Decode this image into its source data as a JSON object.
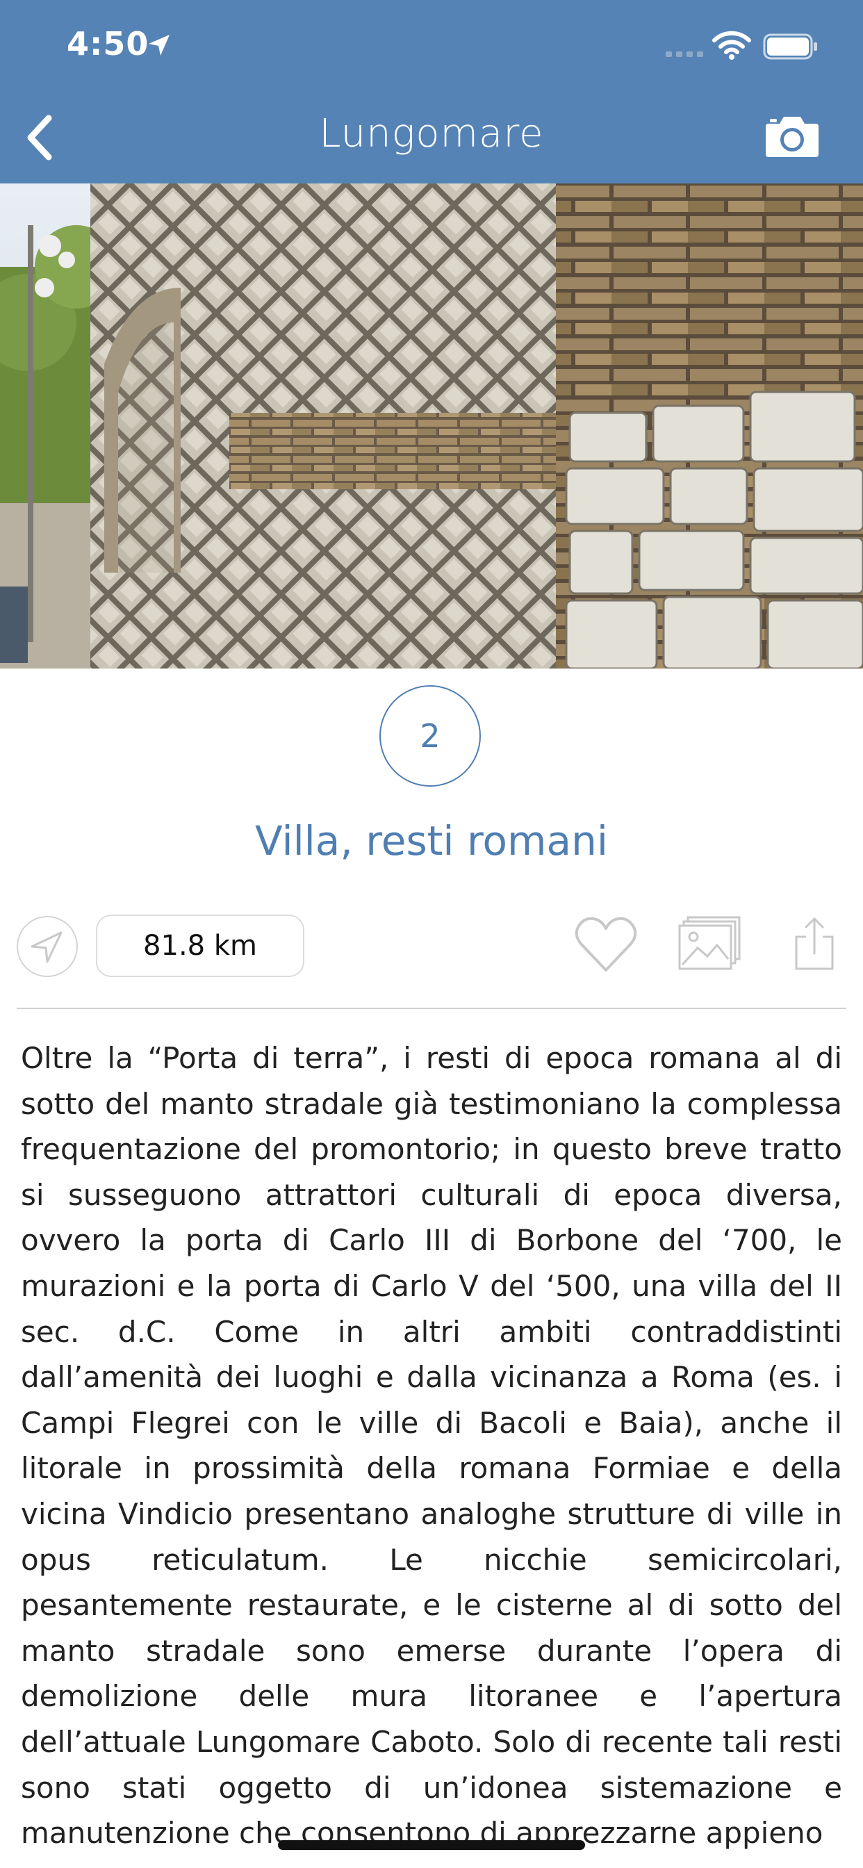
{
  "status_bar": {
    "time": "4:50",
    "icons": [
      "location-arrow-icon",
      "signal-icon",
      "wifi-icon",
      "battery-icon"
    ]
  },
  "nav": {
    "back_icon": "chevron-left-icon",
    "title": "Lungomare",
    "camera_icon": "camera-icon"
  },
  "hero_image": {
    "description": "Roman ruins: arched wall of opus reticulatum, brick and stone masonry along a seaside promenade"
  },
  "poi": {
    "number": "2",
    "title": "Villa, resti romani"
  },
  "actions": {
    "navigate_icon": "navigation-arrow-icon",
    "distance": "81.8 km",
    "favorite_icon": "heart-icon",
    "gallery_icon": "gallery-icon",
    "share_icon": "share-icon"
  },
  "description": "Oltre la “Porta di terra”, i resti di epoca romana al di sotto del manto stradale già testimoniano la complessa frequentazione del promontorio; in questo breve tratto si susseguono attrattori culturali di epoca diversa, ovvero la porta di Carlo III di Borbone del ‘700, le murazioni e la porta di Carlo V del ‘500, una villa del II sec. d.C. Come in altri ambiti contraddistinti dall’amenità dei luoghi e dalla vicinanza a Roma (es. i Campi Flegrei con le ville di Bacoli e Baia), anche il litorale in prossimità della romana Formiae e della vicina Vindicio presentano analoghe strutture di ville in opus reticulatum. Le nicchie semicircolari, pesantemente restaurate, e le cisterne al di sotto del manto stradale sono emerse durante l’opera di demolizione delle mura litoranee e l’apertura dell’attuale Lungomare Caboto. Solo di recente tali resti sono stati oggetto di un’idonea sistemazione e manutenzione che consentono di apprezzarne appieno",
  "colors": {
    "header": "#5583b5",
    "accent": "#4f7eb2",
    "text": "#222222"
  }
}
